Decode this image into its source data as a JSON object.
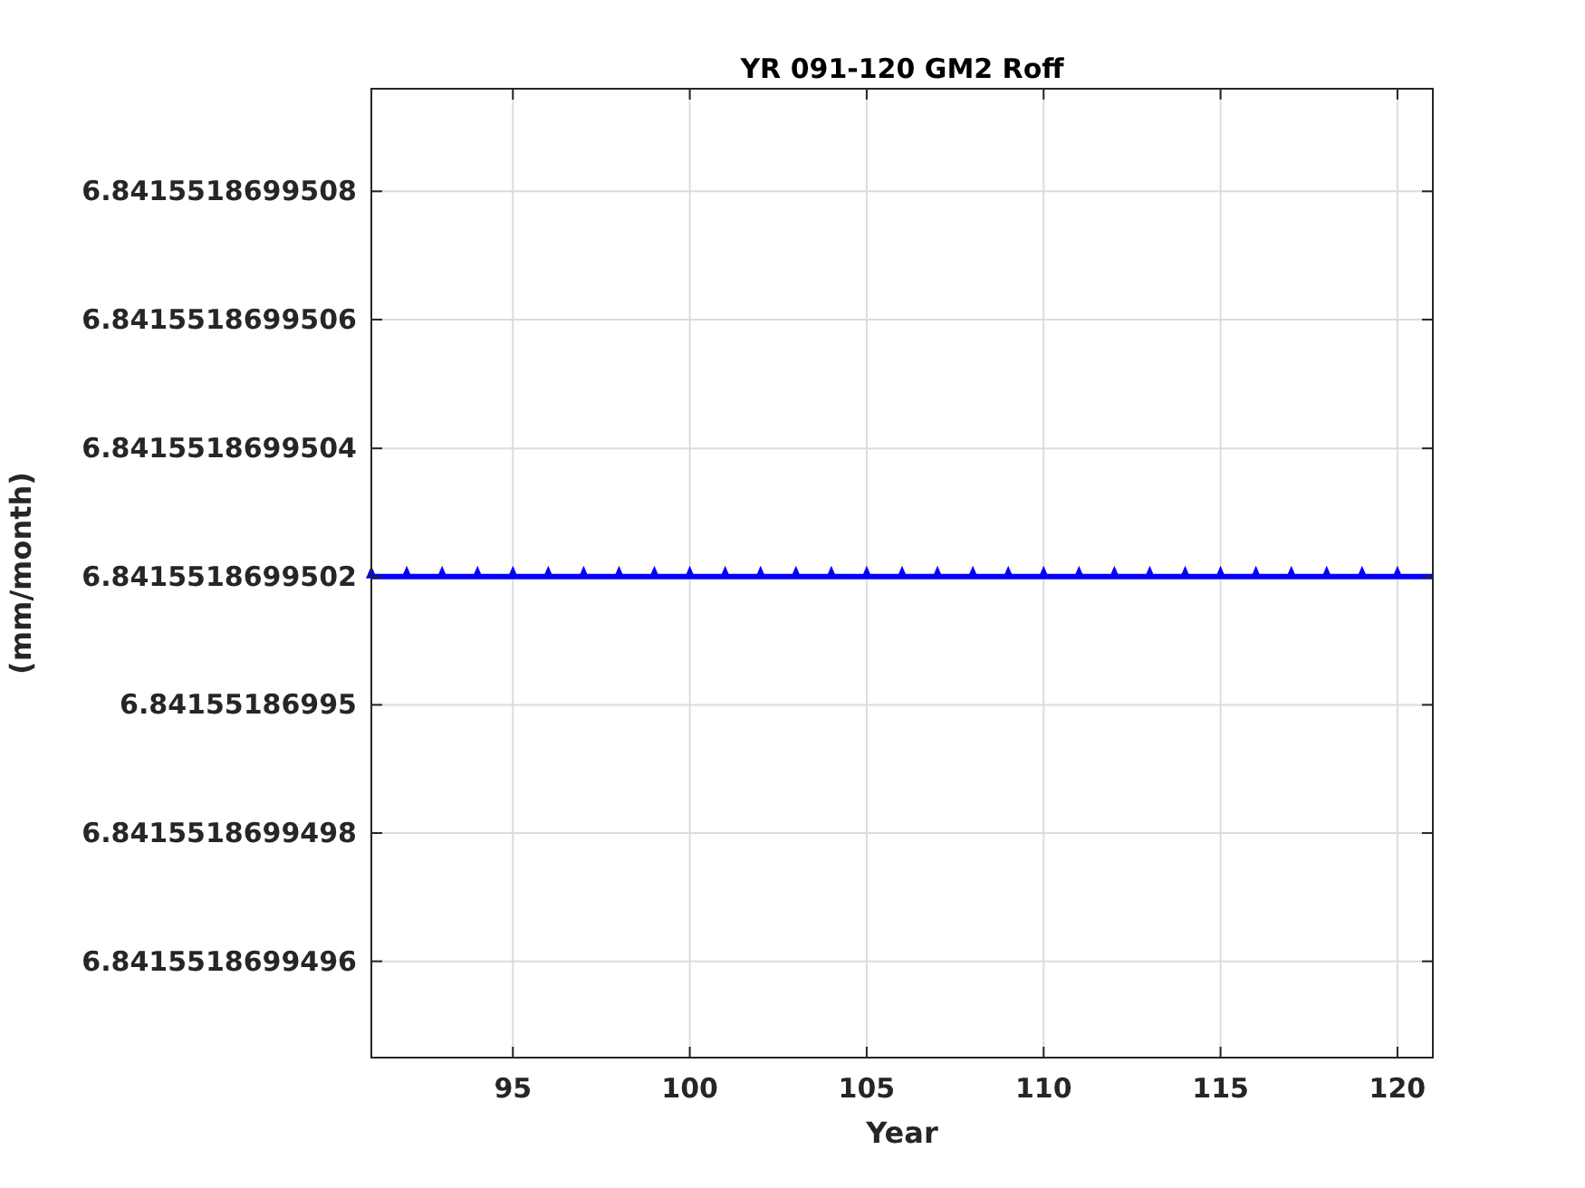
{
  "figure": {
    "chart_data": {
      "type": "line",
      "title": "YR 091-120 GM2 Roff",
      "xlabel": "Year",
      "ylabel": "(mm/month)",
      "x": [
        91,
        92,
        93,
        94,
        95,
        96,
        97,
        98,
        99,
        100,
        101,
        102,
        103,
        104,
        105,
        106,
        107,
        108,
        109,
        110,
        111,
        112,
        113,
        114,
        115,
        116,
        117,
        118,
        119,
        120,
        121
      ],
      "grid": true,
      "series": [
        {
          "color": "#0000ff",
          "marker": "triangle",
          "values": [
            6.8415518699502,
            6.8415518699502,
            6.8415518699502,
            6.8415518699502,
            6.8415518699502,
            6.8415518699502,
            6.8415518699502,
            6.8415518699502,
            6.8415518699502,
            6.8415518699502,
            6.8415518699502,
            6.8415518699502,
            6.8415518699502,
            6.8415518699502,
            6.8415518699502,
            6.8415518699502,
            6.8415518699502,
            6.8415518699502,
            6.8415518699502,
            6.8415518699502,
            6.8415518699502,
            6.8415518699502,
            6.8415518699502,
            6.8415518699502,
            6.8415518699502,
            6.8415518699502,
            6.8415518699502,
            6.8415518699502,
            6.8415518699502,
            6.8415518699502,
            6.8415518699502
          ]
        }
      ],
      "xlim": [
        91,
        121
      ],
      "ylim": [
        6.84155186994945,
        6.84155186995096
      ],
      "xticks": [
        95,
        100,
        105,
        110,
        115,
        120
      ],
      "yticks": [
        {
          "value": 6.8415518699496,
          "label": "6.8415518699496"
        },
        {
          "value": 6.8415518699498,
          "label": "6.8415518699498"
        },
        {
          "value": 6.84155186995,
          "label": "6.84155186995"
        },
        {
          "value": 6.8415518699502,
          "label": "6.8415518699502"
        },
        {
          "value": 6.8415518699504,
          "label": "6.8415518699504"
        },
        {
          "value": 6.8415518699506,
          "label": "6.8415518699506"
        },
        {
          "value": 6.8415518699508,
          "label": "6.8415518699508"
        }
      ]
    }
  }
}
